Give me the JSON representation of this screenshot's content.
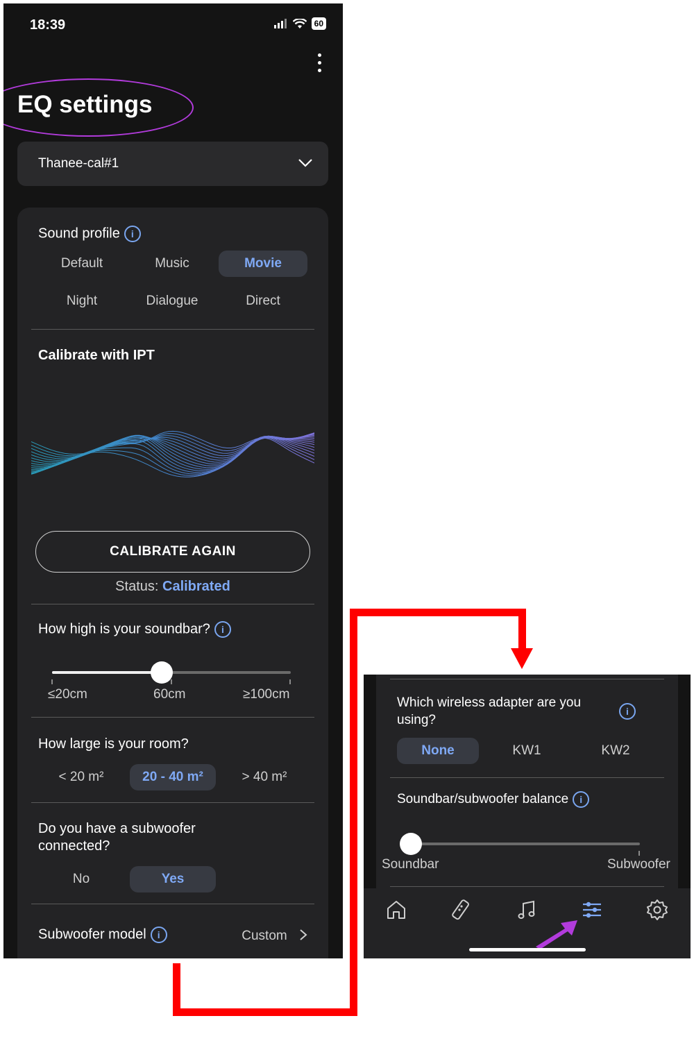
{
  "status_bar": {
    "time": "18:39",
    "battery": "60"
  },
  "header": {
    "title": "EQ settings"
  },
  "device": {
    "name": "Thanee-cal#1"
  },
  "sound_profile": {
    "title": "Sound profile",
    "options": [
      "Default",
      "Music",
      "Movie",
      "Night",
      "Dialogue",
      "Direct"
    ],
    "selected": "Movie"
  },
  "calibrate": {
    "title": "Calibrate with IPT",
    "button": "CALIBRATE AGAIN",
    "status_label": "Status:",
    "status_value": "Calibrated"
  },
  "soundbar_height": {
    "title": "How high is your soundbar?",
    "ticks": [
      "≤20cm",
      "60cm",
      "≥100cm"
    ],
    "value_fraction": 0.46
  },
  "room_size": {
    "title": "How large is your room?",
    "options": [
      "< 20 m²",
      "20 - 40 m²",
      "> 40 m²"
    ],
    "selected": "20 - 40 m²"
  },
  "subwoofer": {
    "title": "Do you have a subwoofer connected?",
    "options": [
      "No",
      "Yes"
    ],
    "selected": "Yes"
  },
  "subwoofer_model": {
    "title": "Subwoofer model",
    "value": "Custom"
  },
  "inset": {
    "wireless_adapter": {
      "title": "Which wireless adapter are you using?",
      "options": [
        "None",
        "KW1",
        "KW2"
      ],
      "selected": "None"
    },
    "balance": {
      "title": "Soundbar/subwoofer balance",
      "left": "Soundbar",
      "right": "Subwoofer",
      "value_fraction": 0.0
    },
    "nav": [
      "home-icon",
      "remote-icon",
      "music-icon",
      "eq-sliders-icon",
      "settings-icon"
    ],
    "active_nav": "eq-sliders-icon"
  },
  "colors": {
    "accent": "#7fa9f5",
    "annotation_red": "#ff0000",
    "annotation_purple": "#b23bdc"
  }
}
